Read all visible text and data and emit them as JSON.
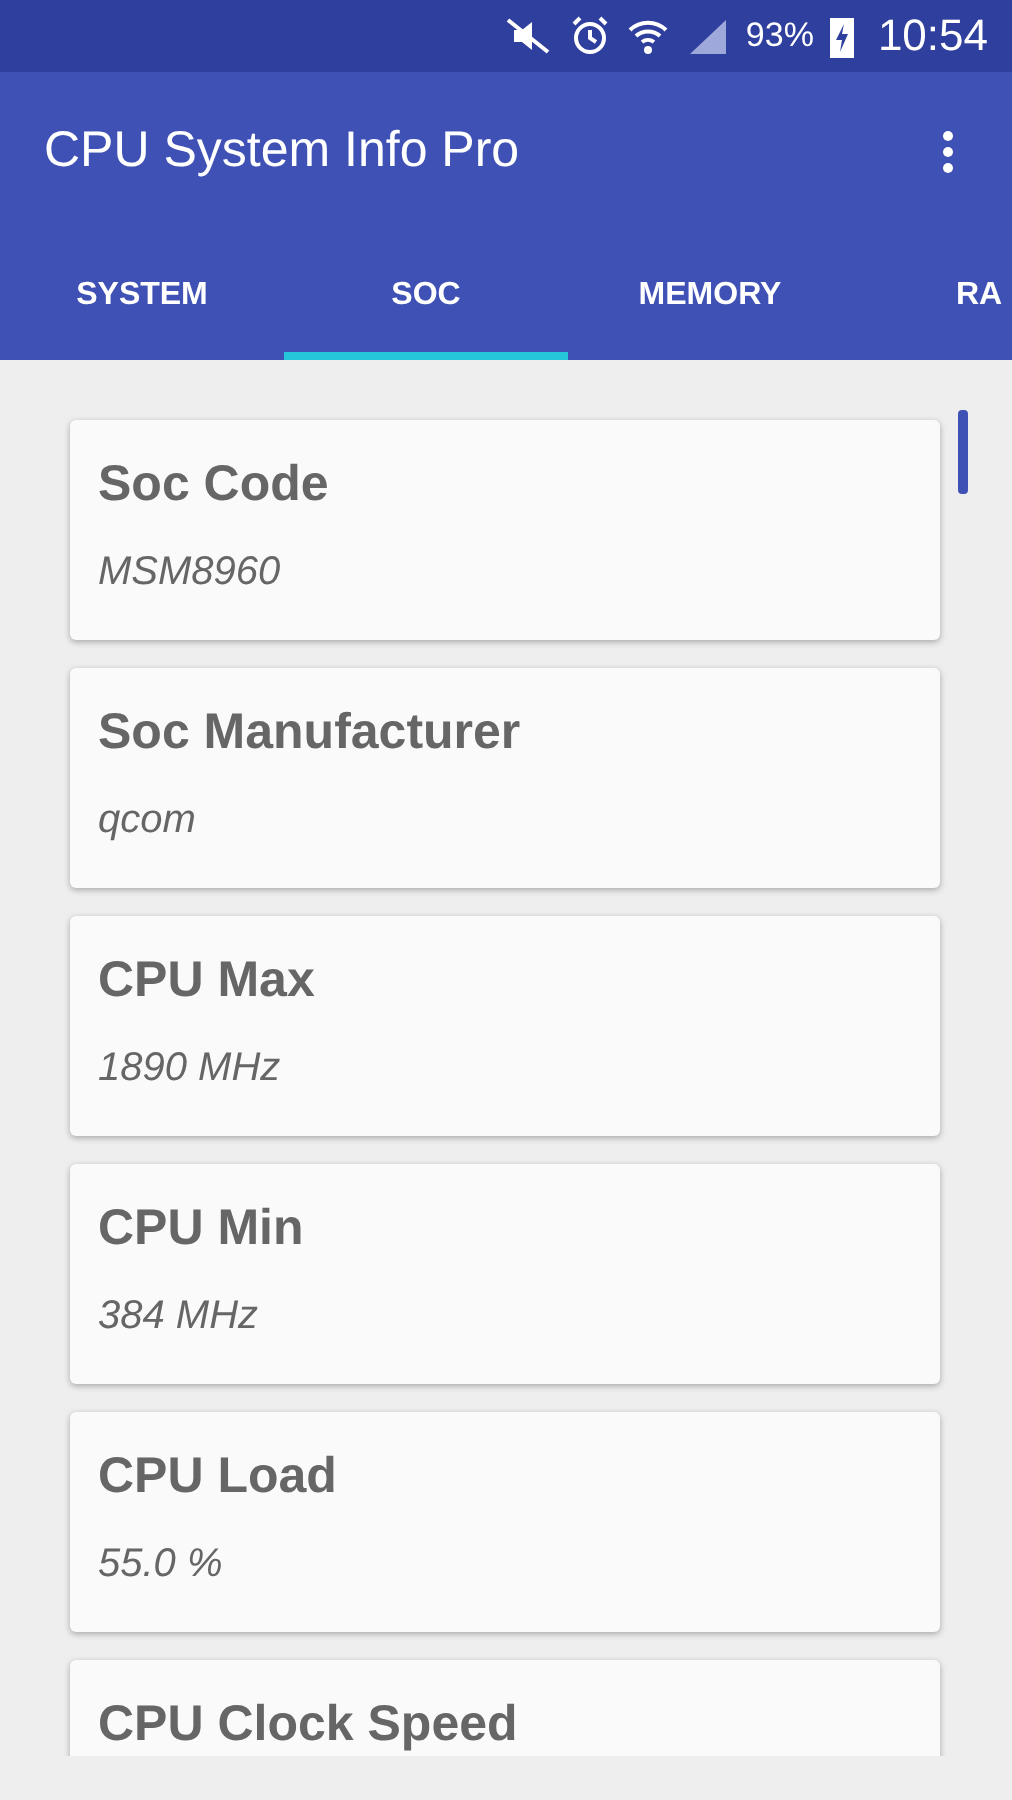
{
  "status_bar": {
    "battery": "93%",
    "time": "10:54"
  },
  "app_bar": {
    "title": "CPU System Info Pro"
  },
  "tabs": [
    {
      "label": "SYSTEM",
      "selected": false
    },
    {
      "label": "SOC",
      "selected": true
    },
    {
      "label": "MEMORY",
      "selected": false
    },
    {
      "label": "RA",
      "selected": false
    }
  ],
  "cards": [
    {
      "title": "Soc Code",
      "value": "MSM8960"
    },
    {
      "title": "Soc Manufacturer",
      "value": "qcom"
    },
    {
      "title": "CPU Max",
      "value": "1890 MHz"
    },
    {
      "title": "CPU Min",
      "value": "384 MHz"
    },
    {
      "title": "CPU Load",
      "value": "55.0 %"
    },
    {
      "title": "CPU Clock Speed"
    }
  ]
}
